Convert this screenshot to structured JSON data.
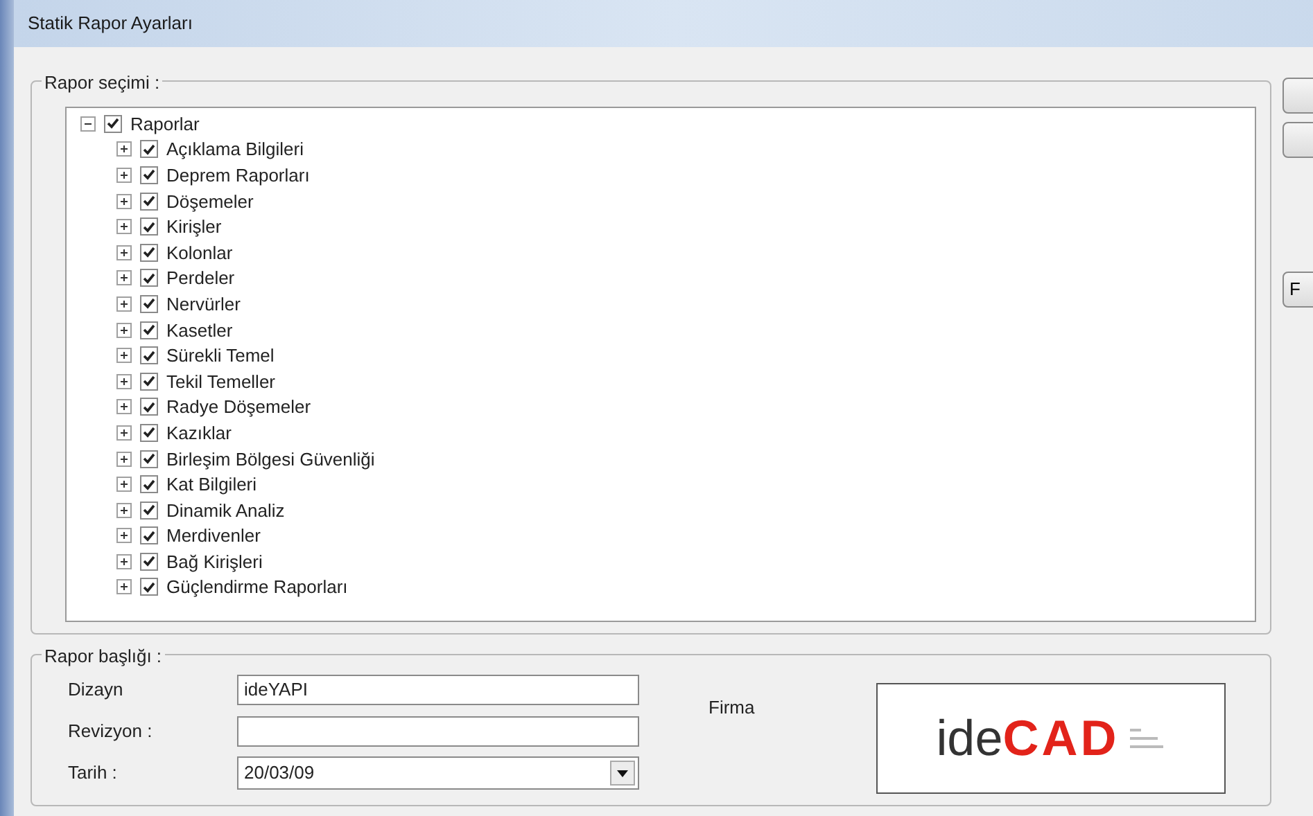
{
  "window": {
    "title": "Statik Rapor Ayarları"
  },
  "report_selection": {
    "label": "Rapor seçimi :",
    "tree": [
      {
        "label": "Raporlar",
        "checked": true,
        "expanded": true,
        "children": [
          {
            "label": "Açıklama Bilgileri",
            "checked": true,
            "expanded": false
          },
          {
            "label": "Deprem Raporları",
            "checked": true,
            "expanded": false
          },
          {
            "label": "Döşemeler",
            "checked": true,
            "expanded": false
          },
          {
            "label": "Kirişler",
            "checked": true,
            "expanded": false
          },
          {
            "label": "Kolonlar",
            "checked": true,
            "expanded": false
          },
          {
            "label": "Perdeler",
            "checked": true,
            "expanded": false
          },
          {
            "label": "Nervürler",
            "checked": true,
            "expanded": false
          },
          {
            "label": "Kasetler",
            "checked": true,
            "expanded": false
          },
          {
            "label": "Sürekli Temel",
            "checked": true,
            "expanded": false
          },
          {
            "label": "Tekil Temeller",
            "checked": true,
            "expanded": false
          },
          {
            "label": "Radye Döşemeler",
            "checked": true,
            "expanded": false
          },
          {
            "label": "Kazıklar",
            "checked": true,
            "expanded": false
          },
          {
            "label": "Birleşim Bölgesi Güvenliği",
            "checked": true,
            "expanded": false
          },
          {
            "label": "Kat Bilgileri",
            "checked": true,
            "expanded": false
          },
          {
            "label": "Dinamik Analiz",
            "checked": true,
            "expanded": false
          },
          {
            "label": "Merdivenler",
            "checked": true,
            "expanded": false
          },
          {
            "label": "Bağ Kirişleri",
            "checked": true,
            "expanded": false
          },
          {
            "label": "Güçlendirme Raporları",
            "checked": true,
            "expanded": false
          }
        ]
      }
    ]
  },
  "side_buttons": [
    {
      "kind": "blank"
    },
    {
      "kind": "blank"
    },
    {
      "kind": "labeled",
      "label": "F"
    }
  ],
  "report_title": {
    "label": "Rapor başlığı :",
    "fields": [
      {
        "label": "Dizayn",
        "value": "ideYAPI",
        "kind": "text"
      },
      {
        "label": "Revizyon :",
        "kind": "text"
      },
      {
        "label": "Tarih :",
        "value": "20/03/09",
        "kind": "combo"
      }
    ],
    "company_label": "Firma",
    "logo": {
      "part_1": "ide",
      "part_2": "CAD"
    }
  }
}
